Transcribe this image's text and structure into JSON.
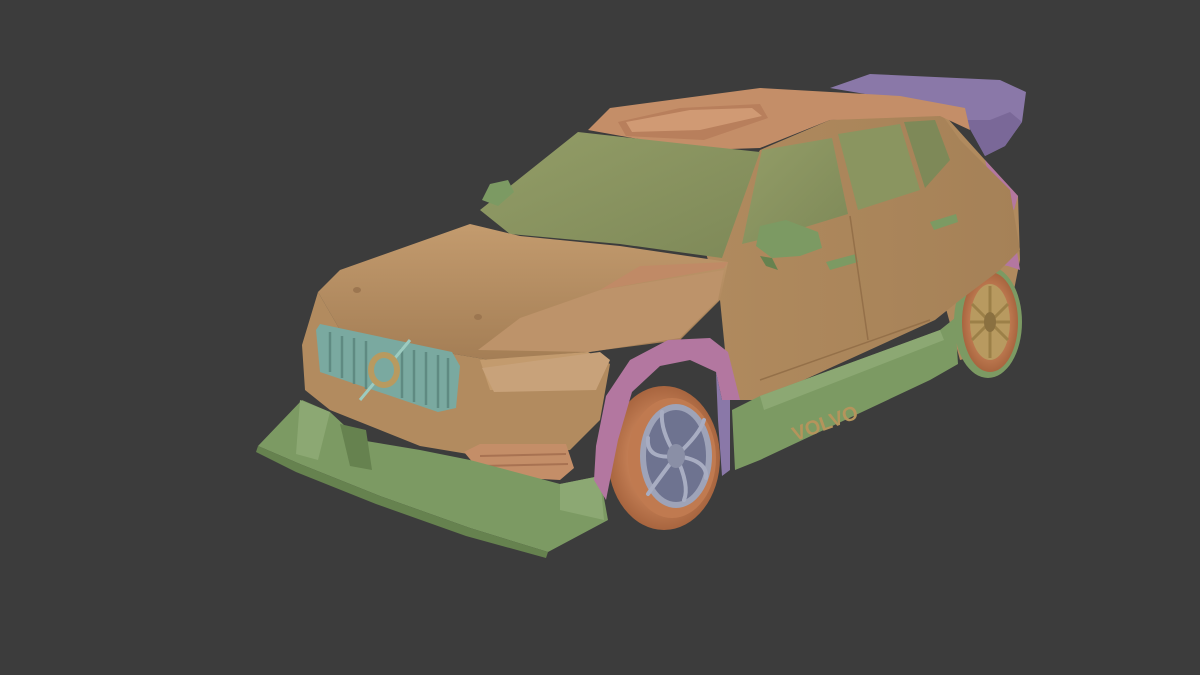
{
  "viewport": {
    "background": "#3c3c3c"
  },
  "model": {
    "badge_text": "VOLVO",
    "colors": {
      "body": "#b58e5f",
      "body_dark": "#9c7650",
      "body_light": "#c39b6e",
      "top_orange": "#c48e68",
      "glass": "#8e9862",
      "glass_dark": "#7b8656",
      "trim_green": "#7c9a63",
      "trim_green_dark": "#66824f",
      "grille_teal": "#7aa9a0",
      "fender_pink": "#b377a0",
      "wing_purple": "#8a78a8",
      "tire_orange": "#c07a50",
      "rim_steel": "#8a8fa6",
      "rim_gold": "#b89a60"
    }
  }
}
